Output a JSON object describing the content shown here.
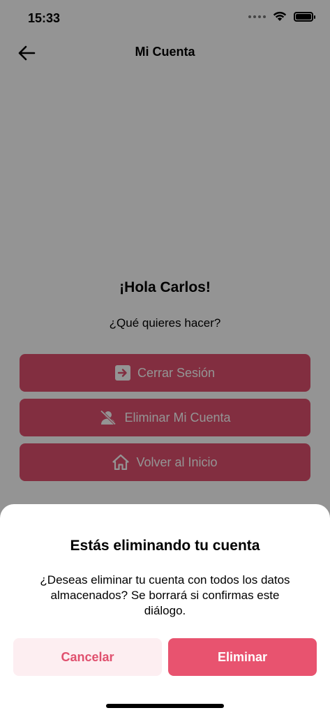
{
  "status_bar": {
    "time": "15:33"
  },
  "nav": {
    "title": "Mi Cuenta",
    "back_icon": "arrow-left-icon"
  },
  "content": {
    "greeting": "¡Hola Carlos!",
    "question": "¿Qué quieres hacer?",
    "actions": [
      {
        "label": "Cerrar Sesión",
        "icon": "logout-icon"
      },
      {
        "label": "Eliminar Mi Cuenta",
        "icon": "user-off-icon"
      },
      {
        "label": "Volver al Inicio",
        "icon": "home-icon"
      }
    ]
  },
  "dialog": {
    "title": "Estás eliminando tu cuenta",
    "message": "¿Deseas eliminar tu cuenta con todos los datos almacenados? Se borrará si confirmas este diálogo.",
    "cancel_label": "Cancelar",
    "confirm_label": "Eliminar"
  },
  "colors": {
    "accent": "#e0506e",
    "cancel_bg": "#fdeef1",
    "confirm_bg": "#e8536f"
  }
}
